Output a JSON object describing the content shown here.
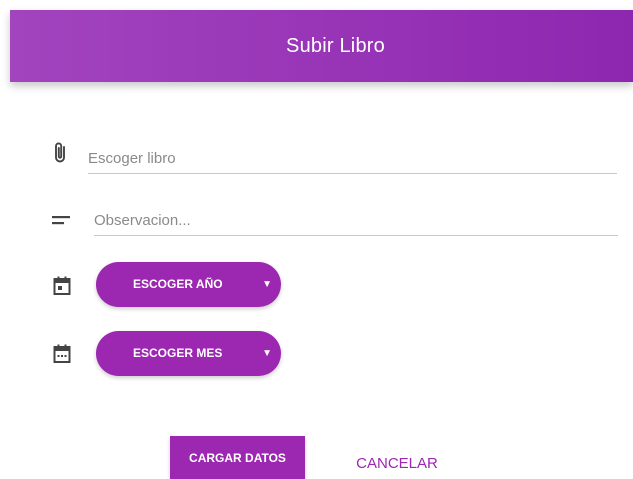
{
  "header": {
    "title": "Subir Libro"
  },
  "form": {
    "book_field": {
      "placeholder": "Escoger libro",
      "value": ""
    },
    "observation_field": {
      "placeholder": "Observacion...",
      "value": ""
    },
    "year_select": {
      "label": "ESCOGER AÑO",
      "caret": "▼"
    },
    "month_select": {
      "label": "ESCOGER MES",
      "caret": "▼"
    }
  },
  "actions": {
    "submit_label": "CARGAR DATOS",
    "cancel_label": "CANCELAR"
  },
  "icons": {
    "book_field": "paperclip-icon",
    "observation_field": "notes-icon",
    "year_select": "calendar-icon",
    "month_select": "calendar-range-icon"
  },
  "colors": {
    "accent": "#9c27b0",
    "header_gradient_start": "#a244be",
    "header_gradient_end": "#8e27b0"
  }
}
